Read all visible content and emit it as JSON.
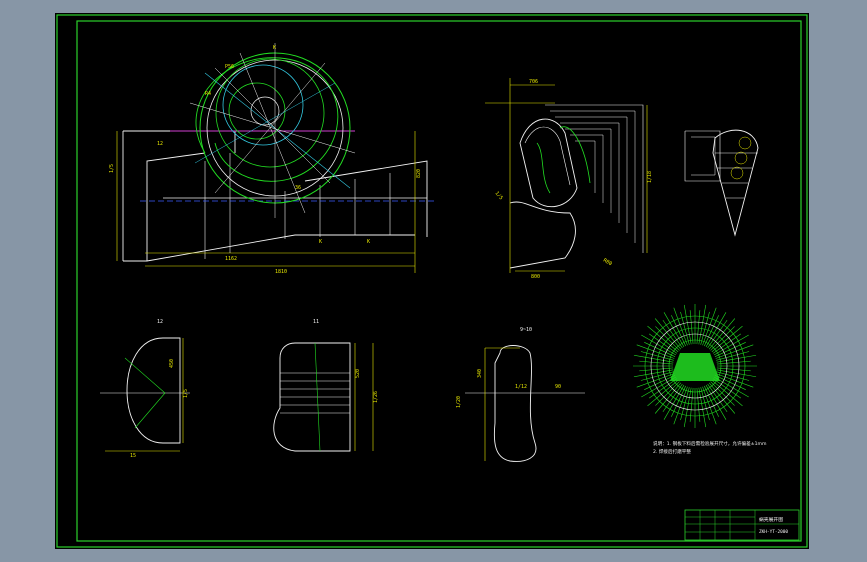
{
  "drawing": {
    "colors": {
      "background": "#8796a6",
      "sheet": "#000000",
      "frame": "#2bd02b",
      "lines": "#f2f2f2",
      "dimensions": "#e8e800",
      "green": "#22dd22",
      "cyan": "#33c8e0",
      "magenta": "#d040d0",
      "blue": "#3a5cff"
    },
    "views": {
      "top_left": {
        "dim_bottom": "1162",
        "dim_bottom2": "1810",
        "dim_left": "1/5",
        "dim_right": "820",
        "labels": [
          "12",
          "K",
          "K",
          "36",
          "K",
          "R4",
          "P56",
          "1/5"
        ]
      },
      "top_middle": {
        "dim_top": "706",
        "dim_bottom": "800",
        "dim_right": "1/18",
        "labels": [
          "1/5",
          "1/5",
          "1/50",
          "R80",
          "R48"
        ]
      },
      "section_12": {
        "title": "12",
        "dims": [
          "450",
          "15",
          "1/5"
        ]
      },
      "section_11": {
        "title": "11",
        "dims": [
          "520",
          "350",
          "1/12",
          "1/26"
        ]
      },
      "section_9": {
        "title": "9~10",
        "dims": [
          "340",
          "1/12",
          "90",
          "1/20"
        ]
      }
    },
    "note": {
      "line1": "说明：1. 钢板下料后需检验展开尺寸，允许偏差±1mm",
      "line2": "2. 焊接后打磨平整"
    },
    "title_block": {
      "name": "蜗壳展开图",
      "code": "ZKH-YT-2000"
    }
  }
}
